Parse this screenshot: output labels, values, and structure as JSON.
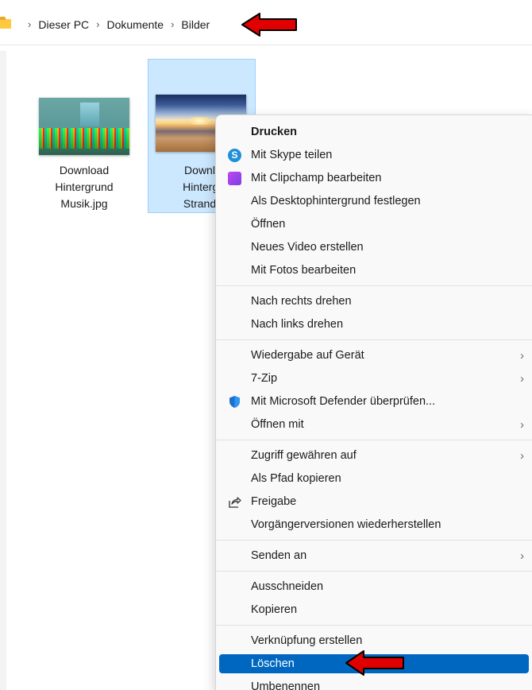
{
  "breadcrumb": {
    "items": [
      "Dieser PC",
      "Dokumente",
      "Bilder"
    ],
    "separator": "›"
  },
  "files": [
    {
      "name_lines": [
        "Download",
        "Hintergrund",
        "Musik.jpg"
      ],
      "selected": false
    },
    {
      "name_lines": [
        "Downlc",
        "Hintergr",
        "Strand.j"
      ],
      "selected": true
    }
  ],
  "context_menu": {
    "groups": [
      [
        {
          "label": "Drucken",
          "bold": true
        },
        {
          "label": "Mit Skype teilen",
          "icon": "skype-icon"
        },
        {
          "label": "Mit Clipchamp bearbeiten",
          "icon": "clipchamp-icon"
        },
        {
          "label": "Als Desktophintergrund festlegen"
        },
        {
          "label": "Öffnen"
        },
        {
          "label": "Neues Video erstellen"
        },
        {
          "label": "Mit Fotos bearbeiten"
        }
      ],
      [
        {
          "label": "Nach rechts drehen"
        },
        {
          "label": "Nach links drehen"
        }
      ],
      [
        {
          "label": "Wiedergabe auf Gerät",
          "submenu": true
        },
        {
          "label": "7-Zip",
          "submenu": true
        },
        {
          "label": "Mit Microsoft Defender überprüfen...",
          "icon": "defender-shield-icon"
        },
        {
          "label": "Öffnen mit",
          "submenu": true
        }
      ],
      [
        {
          "label": "Zugriff gewähren auf",
          "submenu": true
        },
        {
          "label": "Als Pfad kopieren"
        },
        {
          "label": "Freigabe",
          "icon": "share-icon"
        },
        {
          "label": "Vorgängerversionen wiederherstellen"
        }
      ],
      [
        {
          "label": "Senden an",
          "submenu": true
        }
      ],
      [
        {
          "label": "Ausschneiden"
        },
        {
          "label": "Kopieren"
        }
      ],
      [
        {
          "label": "Verknüpfung erstellen"
        },
        {
          "label": "Löschen",
          "highlighted": true
        },
        {
          "label": "Umbenennen"
        }
      ]
    ],
    "submenu_glyph": "›"
  },
  "colors": {
    "selection_fill": "#cce8ff",
    "menu_highlight": "#0067c0",
    "callout_arrow": "#e00000"
  }
}
